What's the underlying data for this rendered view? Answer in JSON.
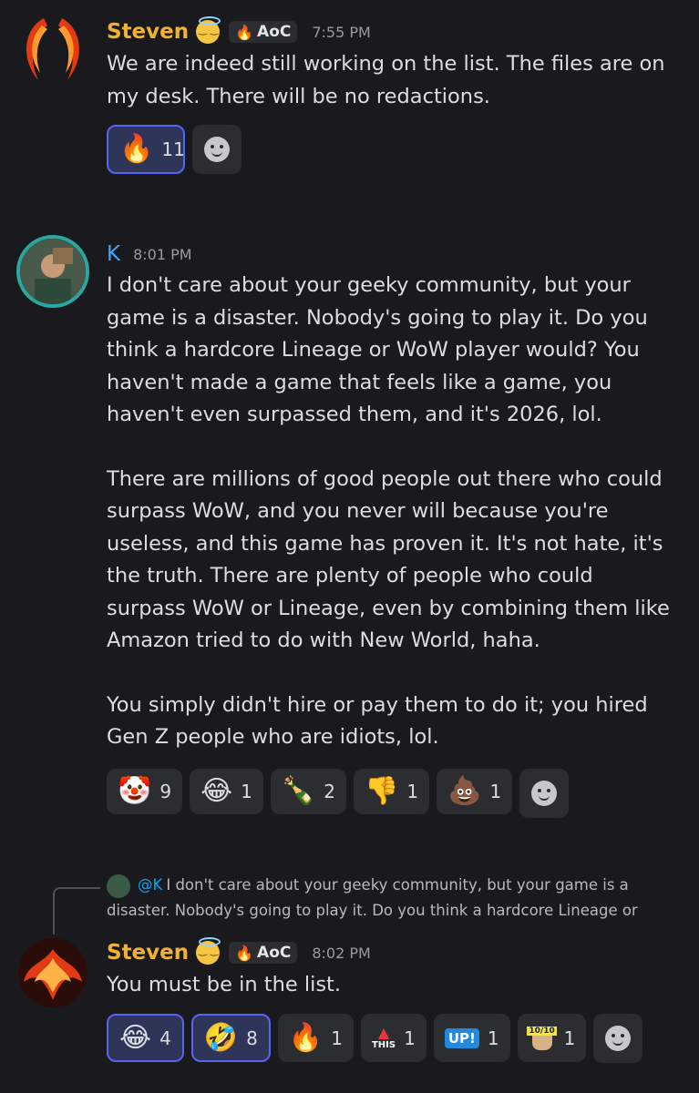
{
  "messages": [
    {
      "author": "Steven",
      "author_color": "#f0b232",
      "tag": "AoC",
      "time": "7:55 PM",
      "paragraphs": [
        "We are indeed still working on the list. The files are on my desk. There will be no redactions."
      ],
      "reactions": [
        {
          "emoji": "🔥",
          "count": "11",
          "active": true
        }
      ]
    },
    {
      "author": "K",
      "author_color": "#3ea6ff",
      "time": "8:01 PM",
      "paragraphs": [
        "I don't care about your geeky community, but your game is a disaster. Nobody's going to play it. Do you think a hardcore Lineage or WoW player would? You haven't made a game that feels like a game, you haven't even surpassed them, and it's 2026, lol.",
        "There are millions of good people out there who could surpass WoW, and you never will because you're useless, and this game has proven it. It's not hate, it's the truth. There are plenty of people who could surpass WoW or Lineage, even by combining them like Amazon tried to do with New World, haha.",
        "You simply didn't hire or pay them to do it; you hired Gen Z people who are idiots, lol."
      ],
      "reactions": [
        {
          "emoji": "🤡",
          "count": "9"
        },
        {
          "emoji": "😂",
          "count": "1"
        },
        {
          "emoji": "🍾",
          "count": "2"
        },
        {
          "emoji": "👎",
          "count": "1"
        },
        {
          "emoji": "💩",
          "count": "1"
        }
      ]
    },
    {
      "reply": {
        "mention": "@K",
        "text": "I don't care about your geeky community, but your game is a disaster. Nobody's going to play it. Do you think a hardcore Lineage or"
      },
      "author": "Steven",
      "author_color": "#f0b232",
      "tag": "AoC",
      "time": "8:02 PM",
      "paragraphs": [
        "You must be in the list."
      ],
      "reactions": [
        {
          "emoji": "😂",
          "count": "4",
          "active": true
        },
        {
          "emoji": "🤣",
          "count": "8",
          "active": true
        },
        {
          "emoji": "🔥",
          "count": "1"
        },
        {
          "emoji": "THIS",
          "count": "1"
        },
        {
          "emoji": "UP!",
          "count": "1"
        },
        {
          "emoji": "10/10",
          "count": "1"
        }
      ]
    }
  ]
}
